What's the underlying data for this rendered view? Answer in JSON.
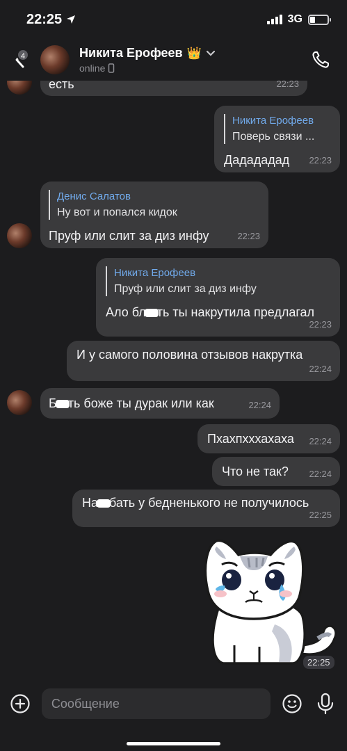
{
  "status_bar": {
    "time": "22:25",
    "network": "3G"
  },
  "header": {
    "back_badge": "4",
    "contact_name": "Никита Ерофеев",
    "crown_emoji": "👑",
    "status": "online"
  },
  "messages": [
    {
      "text": "есть",
      "time": "22:23"
    },
    {
      "quote_author": "Никита Ерофеев",
      "quote_text": "Поверь связи ...",
      "text": "Дадададад",
      "time": "22:23"
    },
    {
      "quote_author": "Денис Салатов",
      "quote_text": "Ну вот и попался кидок",
      "text": "Пруф или слит за диз инфу",
      "time": "22:23"
    },
    {
      "quote_author": "Никита Ерофеев",
      "quote_text": "Пруф или слит за диз инфу",
      "text_a": "Ало бл",
      "text_b": "ть ты накрутила предлагал",
      "time": "22:23"
    },
    {
      "text": "И у самого половина отзывов накрутка",
      "time": "22:24"
    },
    {
      "text_a": "Б",
      "text_b": "ть боже ты дурак или как",
      "time": "22:24"
    },
    {
      "text": "Пхахпхххахаха",
      "time": "22:24"
    },
    {
      "text": "Что не так?",
      "time": "22:24"
    },
    {
      "text_a": "На",
      "text_b": "бать у бедненького не получилось",
      "time": "22:25"
    }
  ],
  "sticker": {
    "time": "22:25"
  },
  "composer": {
    "placeholder": "Сообщение"
  },
  "colors": {
    "background": "#1c1c1e",
    "bubble": "#3a3a3c",
    "quote_author": "#71aaeb"
  }
}
